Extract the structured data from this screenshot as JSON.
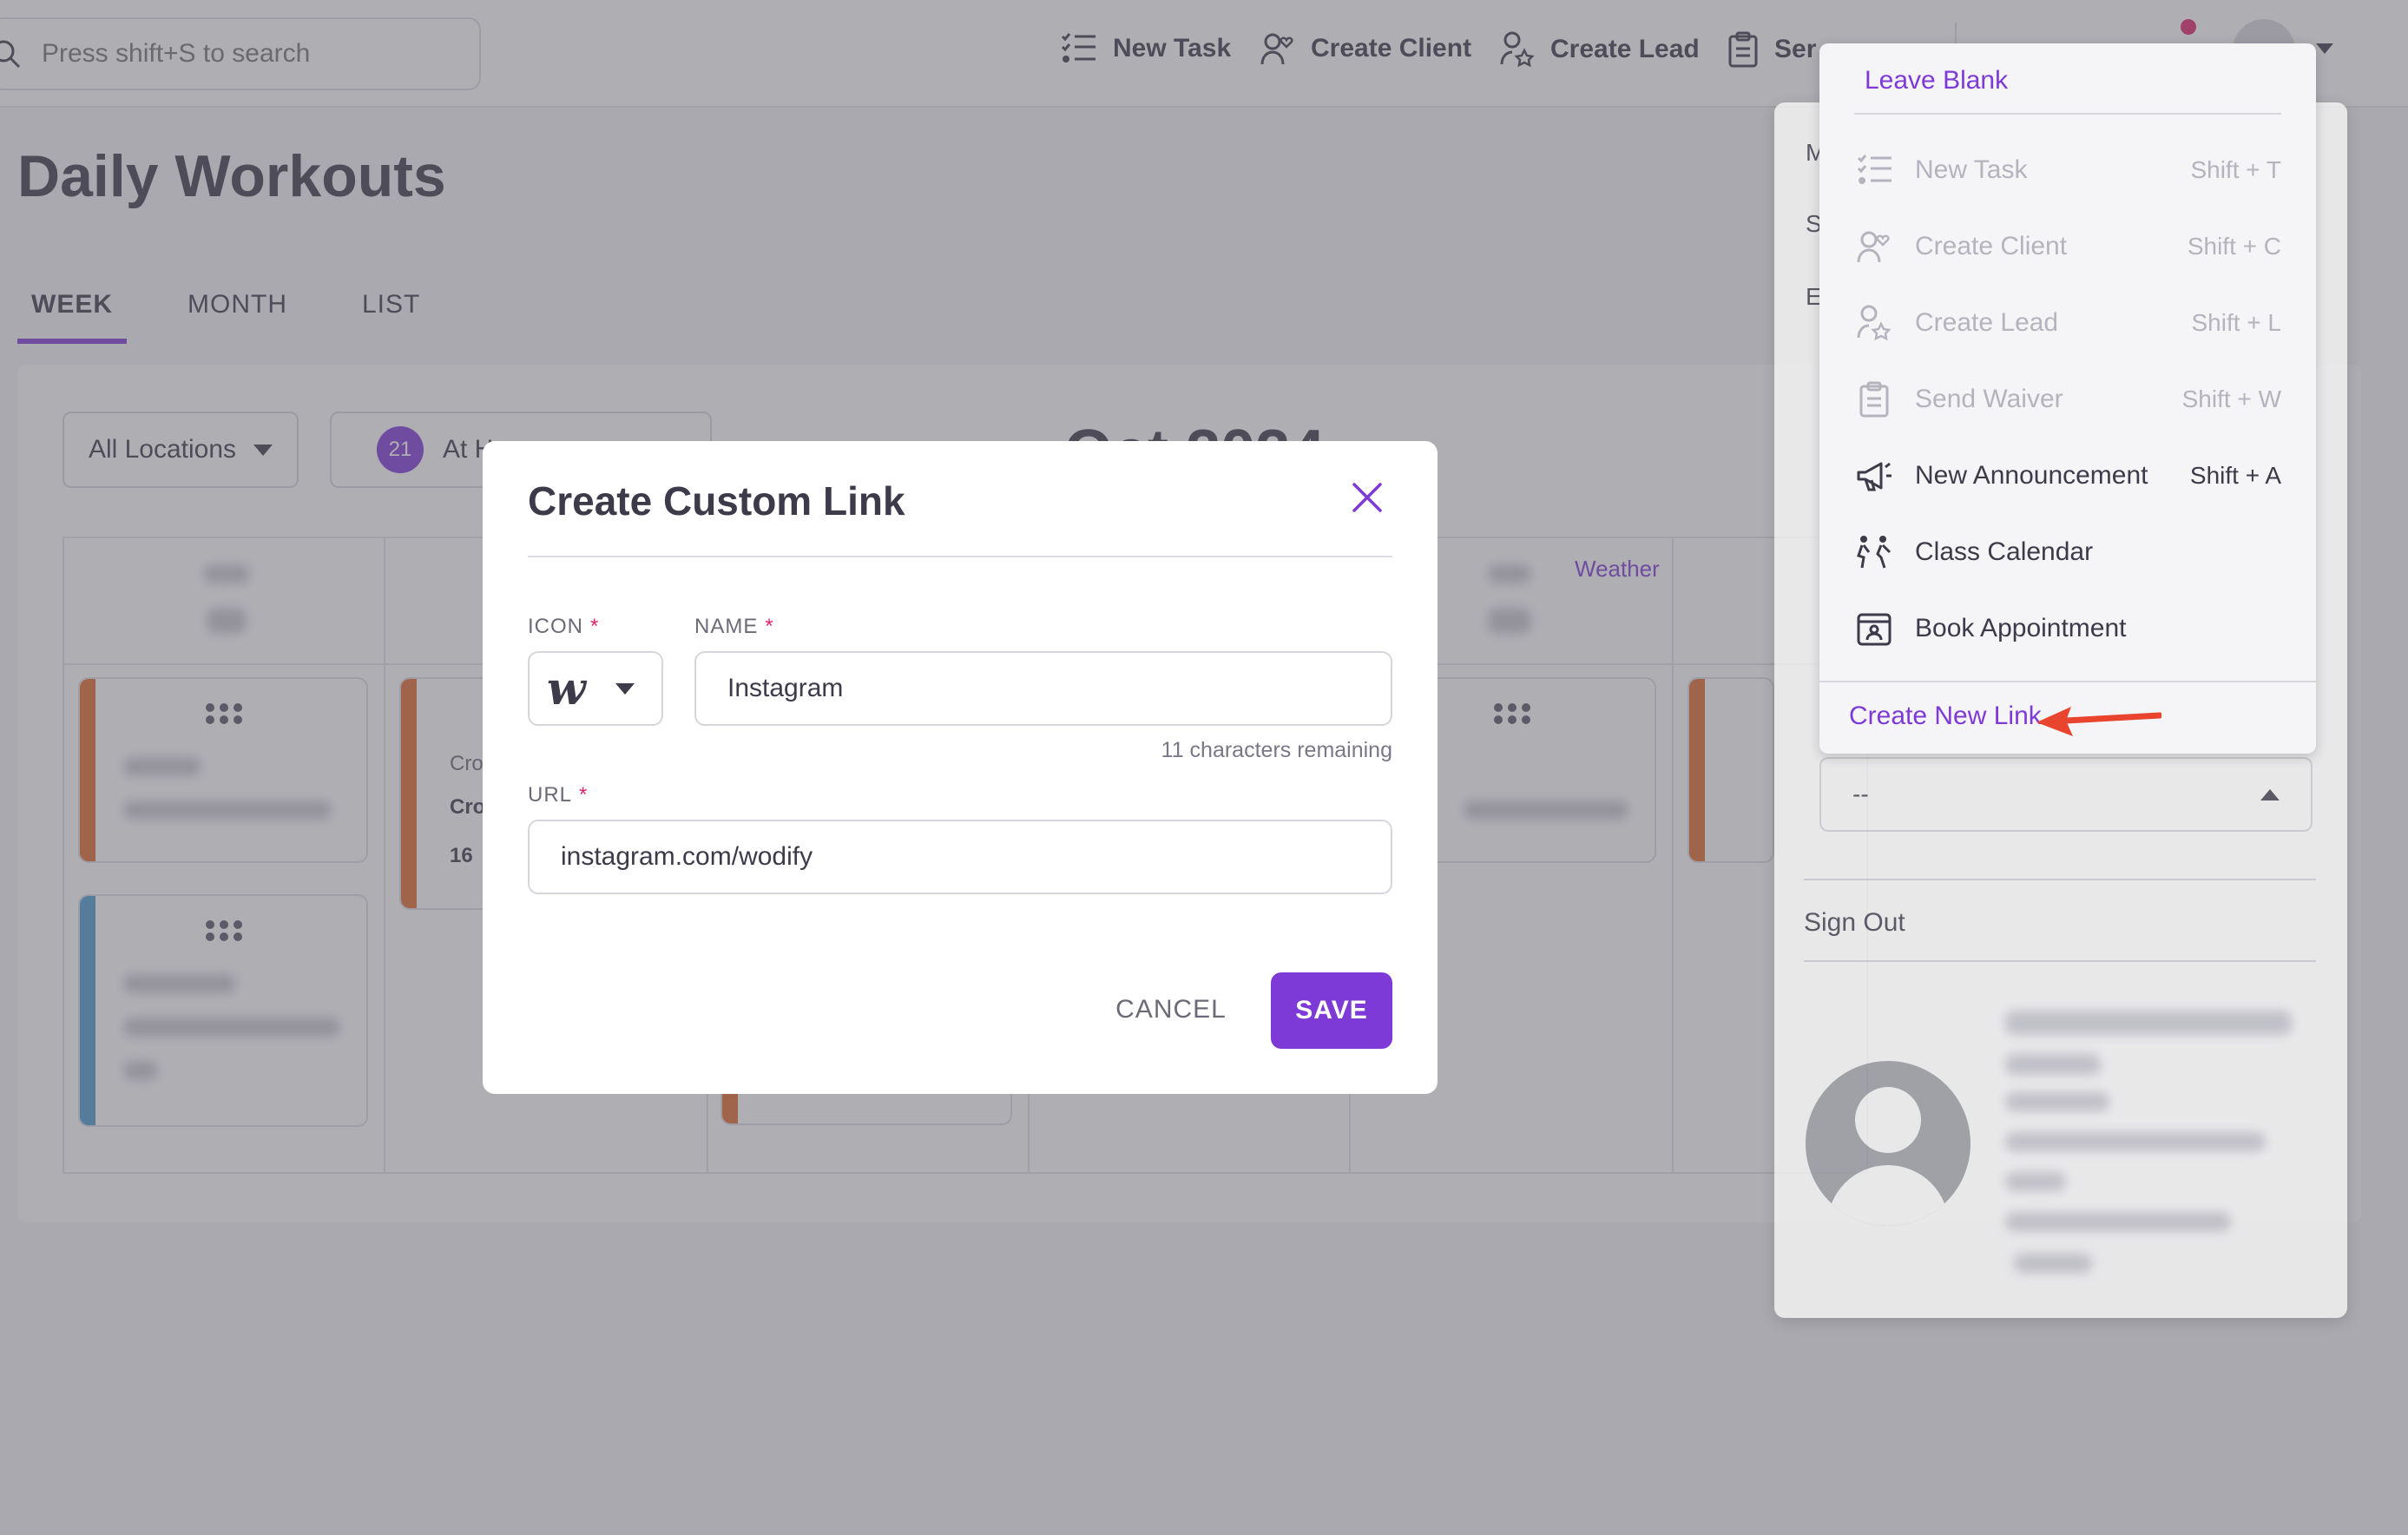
{
  "search": {
    "placeholder": "Press shift+S to search"
  },
  "topbar": {
    "actions": [
      {
        "label": "New Task",
        "icon": "task-list-icon"
      },
      {
        "label": "Create Client",
        "icon": "user-heart-icon"
      },
      {
        "label": "Create Lead",
        "icon": "user-star-icon"
      },
      {
        "label": "Ser",
        "icon": "clipboard-icon"
      }
    ]
  },
  "page": {
    "title": "Daily Workouts",
    "tabs": [
      {
        "label": "WEEK",
        "active": true
      },
      {
        "label": "MONTH"
      },
      {
        "label": "LIST"
      }
    ]
  },
  "calendar": {
    "location_filter": "All Locations",
    "filter_count": "21",
    "filter_label": "At H",
    "period_title": "Oct 2024",
    "weather_link": "Weather",
    "card_texts": {
      "line1": "Cro",
      "line2": "Cro",
      "line3": "16"
    }
  },
  "profile_menu": {
    "initials": [
      "M",
      "S",
      "E"
    ],
    "select_value": "--",
    "sign_out": "Sign Out"
  },
  "quick_menu": {
    "leave_blank": "Leave Blank",
    "items": [
      {
        "label": "New Task",
        "shortcut": "Shift + T",
        "icon": "task-list-icon",
        "enabled": false
      },
      {
        "label": "Create Client",
        "shortcut": "Shift + C",
        "icon": "user-heart-icon",
        "enabled": false
      },
      {
        "label": "Create Lead",
        "shortcut": "Shift + L",
        "icon": "user-star-icon",
        "enabled": false
      },
      {
        "label": "Send Waiver",
        "shortcut": "Shift + W",
        "icon": "clipboard-icon",
        "enabled": false
      },
      {
        "label": "New Announcement",
        "shortcut": "Shift + A",
        "icon": "megaphone-icon",
        "enabled": true
      },
      {
        "label": "Class Calendar",
        "shortcut": "",
        "icon": "workout-people-icon",
        "enabled": true
      },
      {
        "label": "Book Appointment",
        "shortcut": "",
        "icon": "calendar-person-icon",
        "enabled": true
      }
    ],
    "create_link": "Create New Link"
  },
  "modal": {
    "title": "Create Custom Link",
    "icon_label": "ICON",
    "icon_value": "w",
    "name_label": "NAME",
    "name_value": "Instagram",
    "name_helper": "11 characters remaining",
    "url_label": "URL",
    "url_value": "instagram.com/wodify",
    "required_mark": "*",
    "cancel_label": "CANCEL",
    "save_label": "SAVE"
  },
  "colors": {
    "accent": "#7e3ad6",
    "required": "#e0246f",
    "annotation": "#e8442e"
  }
}
